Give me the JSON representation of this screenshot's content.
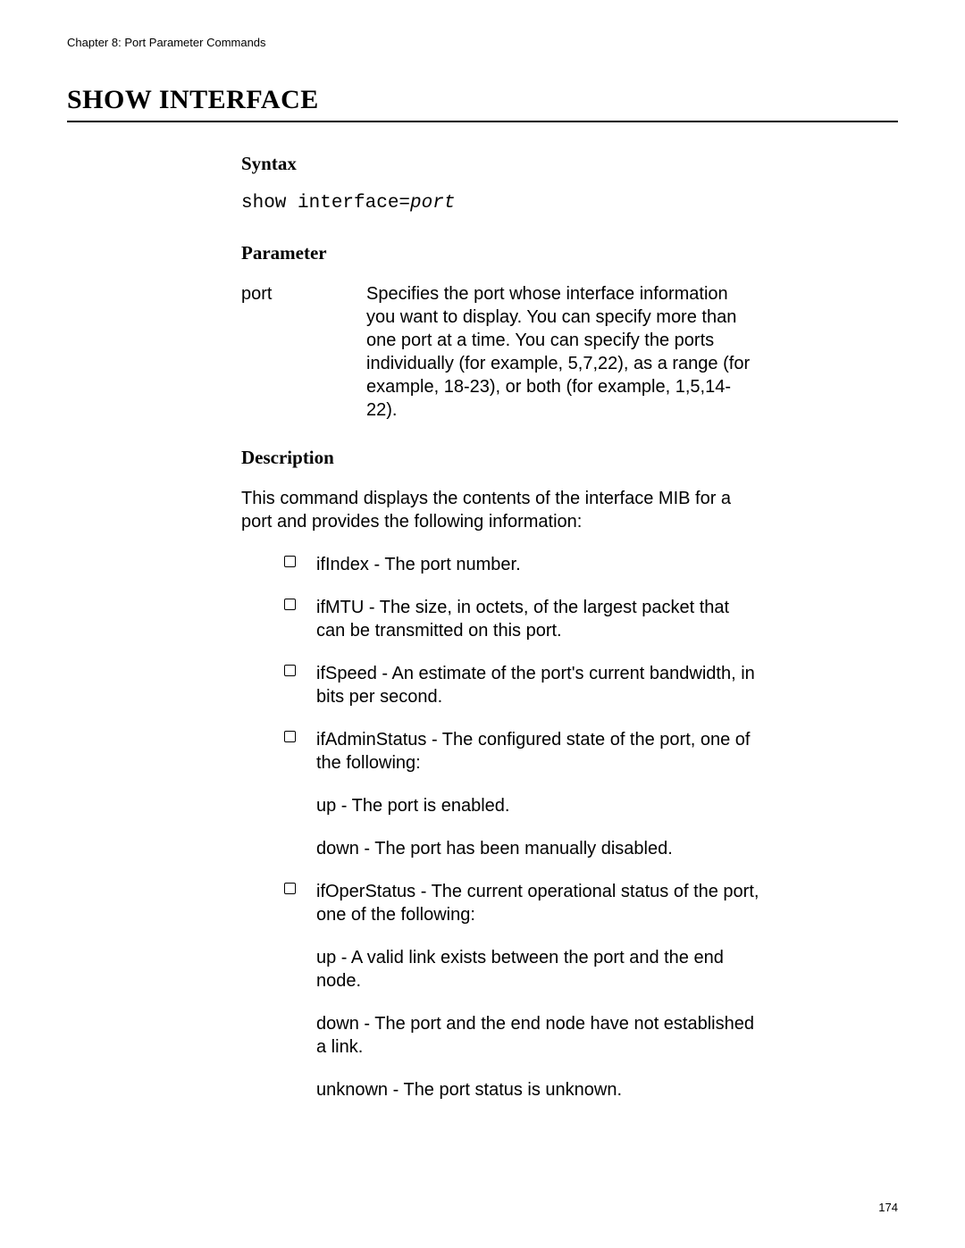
{
  "chapter_header": "Chapter 8: Port Parameter Commands",
  "title": "SHOW INTERFACE",
  "syntax": {
    "heading": "Syntax",
    "command": "show interface=",
    "arg": "port"
  },
  "parameter": {
    "heading": "Parameter",
    "name": "port",
    "desc": "Specifies the port whose interface information you want to display. You can specify more than one port at a time. You can specify the ports individually (for example, 5,7,22), as a range (for example, 18-23), or both (for example, 1,5,14-22)."
  },
  "description": {
    "heading": "Description",
    "intro": "This command displays the contents of the interface MIB for a port and provides the following information:",
    "items": [
      "ifIndex - The port number.",
      "ifMTU - The size, in octets, of the largest packet that can be transmitted on this port.",
      "ifSpeed - An estimate of the port's current bandwidth, in bits per second.",
      "ifAdminStatus - The configured state of the port, one of the following:"
    ],
    "admin_sub": [
      "up - The port is enabled.",
      "down - The port has been manually disabled."
    ],
    "oper_item": "ifOperStatus - The current operational status of the port, one of the following:",
    "oper_sub": [
      "up - A valid link exists between the port and the end node.",
      "down - The port and the end node have not established a link.",
      "unknown - The port status is unknown."
    ]
  },
  "page_number": "174"
}
